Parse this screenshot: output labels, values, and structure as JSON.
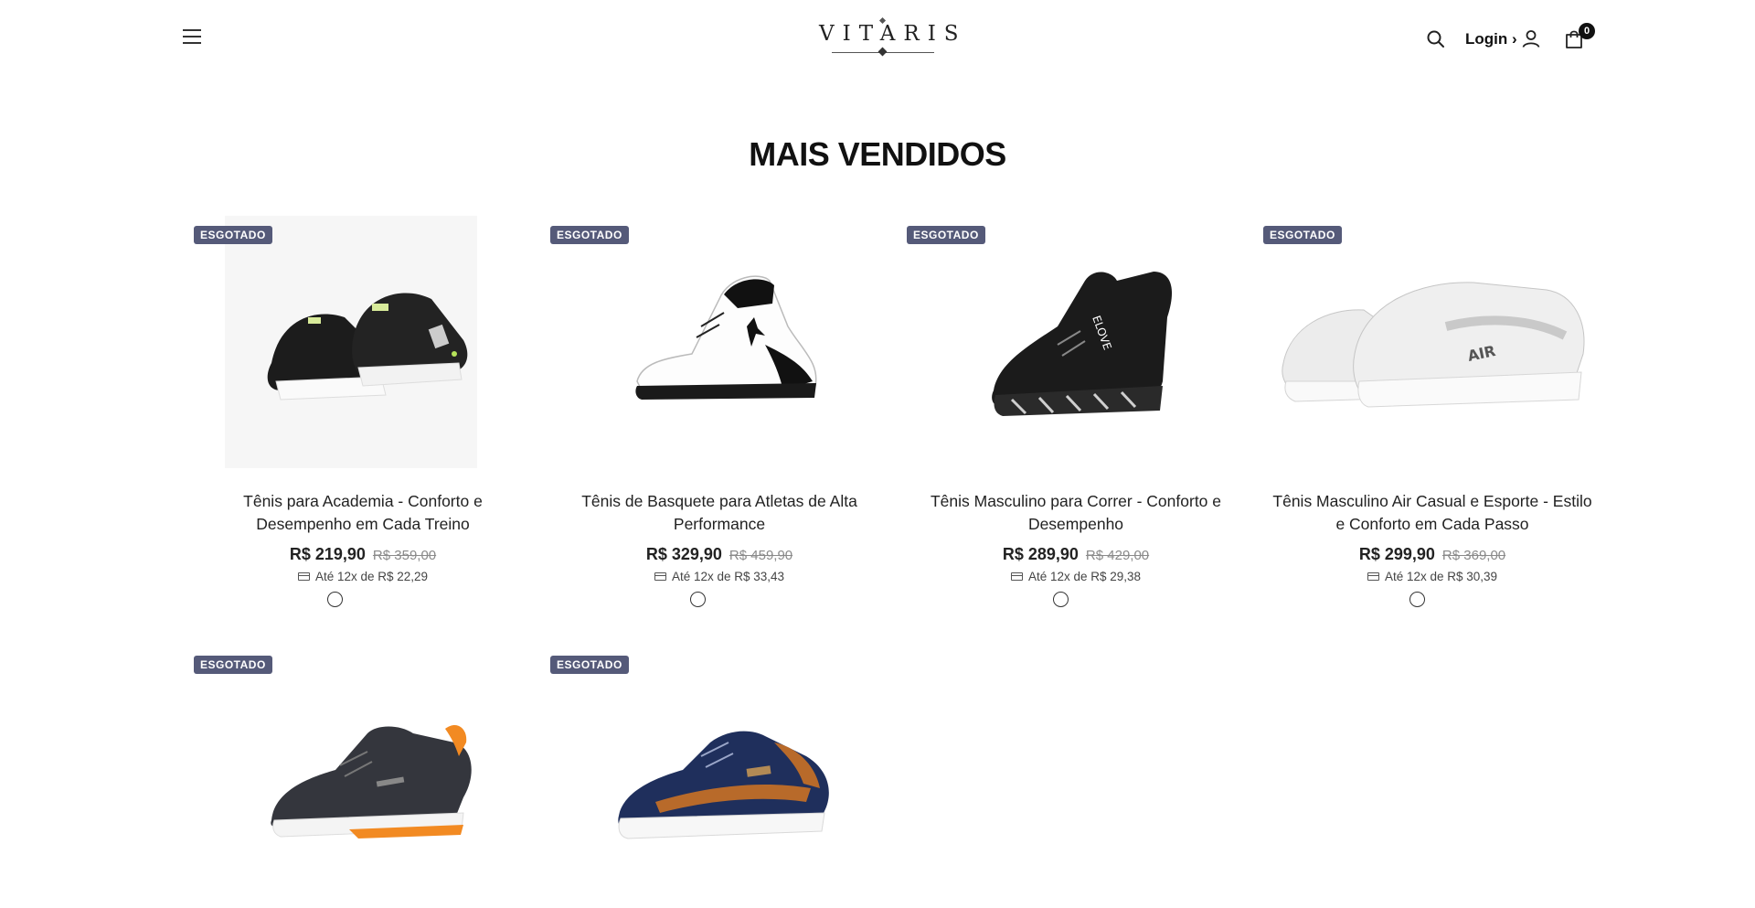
{
  "header": {
    "logo_text": "VITARIS",
    "login_label": "Login ›",
    "cart_count": "0"
  },
  "section": {
    "title": "MAIS VENDIDOS"
  },
  "products": [
    {
      "badge": "ESGOTADO",
      "title": "Tênis para Academia - Conforto e Desempenho em Cada Treino",
      "price": "R$ 219,90",
      "old_price": "R$ 359,00",
      "installment": "Até 12x de R$ 22,29"
    },
    {
      "badge": "ESGOTADO",
      "title": "Tênis de Basquete para Atletas de Alta Performance",
      "price": "R$ 329,90",
      "old_price": "R$ 459,90",
      "installment": "Até 12x de R$ 33,43"
    },
    {
      "badge": "ESGOTADO",
      "title": "Tênis Masculino para Correr - Conforto e Desempenho",
      "price": "R$ 289,90",
      "old_price": "R$ 429,00",
      "installment": "Até 12x de R$ 29,38"
    },
    {
      "badge": "ESGOTADO",
      "title": "Tênis Masculino Air Casual e Esporte - Estilo e Conforto em Cada Passo",
      "price": "R$ 299,90",
      "old_price": "R$ 369,00",
      "installment": "Até 12x de R$ 30,39"
    },
    {
      "badge": "ESGOTADO"
    },
    {
      "badge": "ESGOTADO"
    }
  ]
}
